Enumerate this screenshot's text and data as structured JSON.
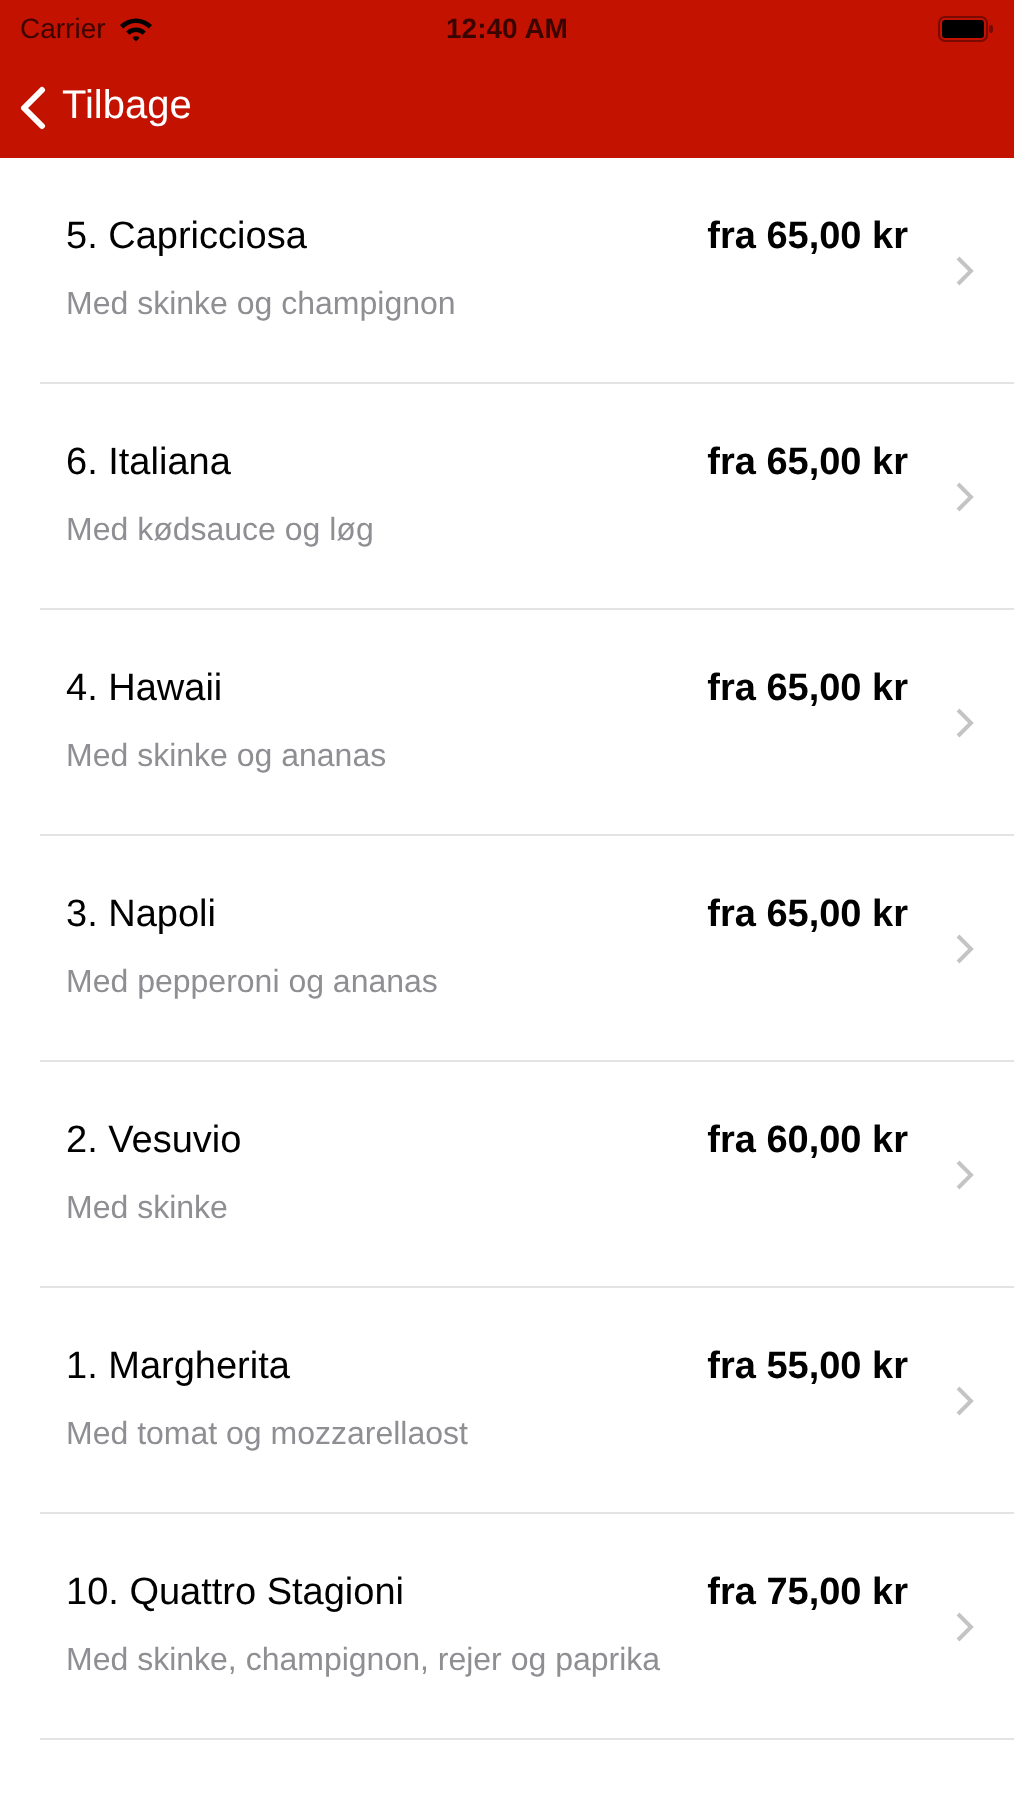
{
  "status_bar": {
    "carrier": "Carrier",
    "time": "12:40 AM"
  },
  "nav_bar": {
    "back_label": "Tilbage"
  },
  "items": [
    {
      "title": "5. Capricciosa",
      "price": "fra 65,00 kr",
      "subtitle": "Med skinke og champignon"
    },
    {
      "title": "6. Italiana",
      "price": "fra 65,00 kr",
      "subtitle": "Med kødsauce og løg"
    },
    {
      "title": "4. Hawaii",
      "price": "fra 65,00 kr",
      "subtitle": "Med skinke og ananas"
    },
    {
      "title": "3. Napoli",
      "price": "fra 65,00 kr",
      "subtitle": "Med pepperoni og ananas"
    },
    {
      "title": "2. Vesuvio",
      "price": "fra 60,00 kr",
      "subtitle": "Med skinke"
    },
    {
      "title": "1. Margherita",
      "price": "fra 55,00 kr",
      "subtitle": "Med tomat og mozzarellaost"
    },
    {
      "title": "10. Quattro Stagioni",
      "price": "fra 75,00 kr",
      "subtitle": "Med skinke, champignon, rejer og paprika"
    }
  ]
}
